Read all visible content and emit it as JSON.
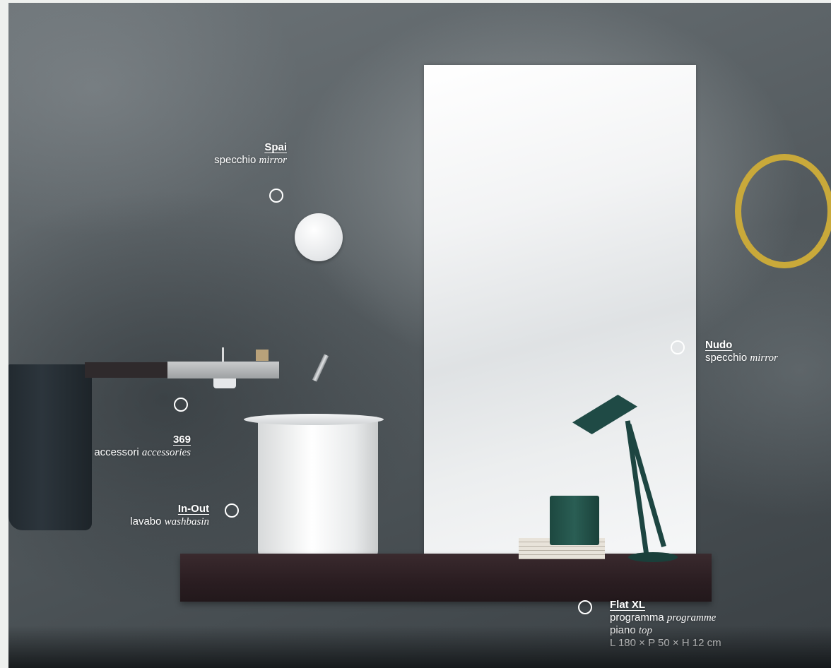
{
  "hotspots": {
    "spai": {
      "name": "Spai",
      "desc_it": "specchio",
      "desc_en": "mirror"
    },
    "nudo": {
      "name": "Nudo",
      "desc_it": "specchio",
      "desc_en": "mirror"
    },
    "acc369": {
      "name": "369",
      "desc_it": "accessori",
      "desc_en": "accessories"
    },
    "inout": {
      "name": "In-Out",
      "desc_it": "lavabo",
      "desc_en": "washbasin"
    },
    "flatxl": {
      "name": "Flat XL",
      "line1_it": "programma",
      "line1_en": "programme",
      "line2_it": "piano",
      "line2_en": "top",
      "dimensions": "L 180 × P 50 × H 12 cm"
    }
  },
  "icons": {
    "marker": "circle-outline-icon"
  },
  "colors": {
    "text": "#ffffff",
    "ring": "#c9a93a",
    "lamp": "#1f4a45"
  }
}
